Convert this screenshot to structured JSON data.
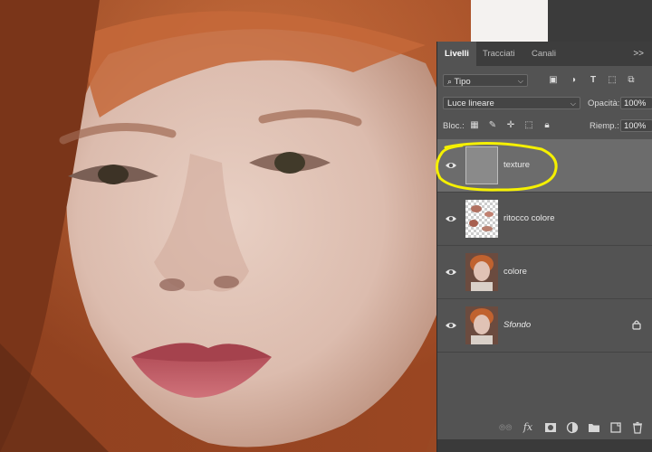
{
  "panel": {
    "tabs": [
      {
        "label": "Livelli",
        "active": true
      },
      {
        "label": "Tracciati",
        "active": false
      },
      {
        "label": "Canali",
        "active": false
      }
    ],
    "overflow_label": ">>",
    "filter": {
      "value": "Tipo"
    },
    "blend_mode": {
      "value": "Luce lineare"
    },
    "opacity": {
      "label": "Opacità:",
      "value": "100%"
    },
    "lock": {
      "label": "Bloc.:"
    },
    "fill": {
      "label": "Riemp.:",
      "value": "100%"
    }
  },
  "layers": [
    {
      "name": "texture",
      "selected": true,
      "visible": true,
      "locked": false,
      "thumb": "gray"
    },
    {
      "name": "ritocco colore",
      "selected": false,
      "visible": true,
      "locked": false,
      "thumb": "transparent-patches"
    },
    {
      "name": "colore",
      "selected": false,
      "visible": true,
      "locked": false,
      "thumb": "portrait"
    },
    {
      "name": "Sfondo",
      "selected": false,
      "visible": true,
      "locked": true,
      "italic": true,
      "thumb": "portrait"
    }
  ],
  "toolbar": {
    "link_icon": "link-icon",
    "fx_label": "fx",
    "mask_icon": "mask-icon",
    "adjustment_icon": "adjustment-icon",
    "group_icon": "folder-icon",
    "new_layer_icon": "new-layer-icon",
    "delete_icon": "trash-icon"
  },
  "colors": {
    "panel_bg": "#535353",
    "tab_bar": "#3d3d3d",
    "selected_layer": "#6c6c6c",
    "highlight_circle": "#f5f000"
  }
}
